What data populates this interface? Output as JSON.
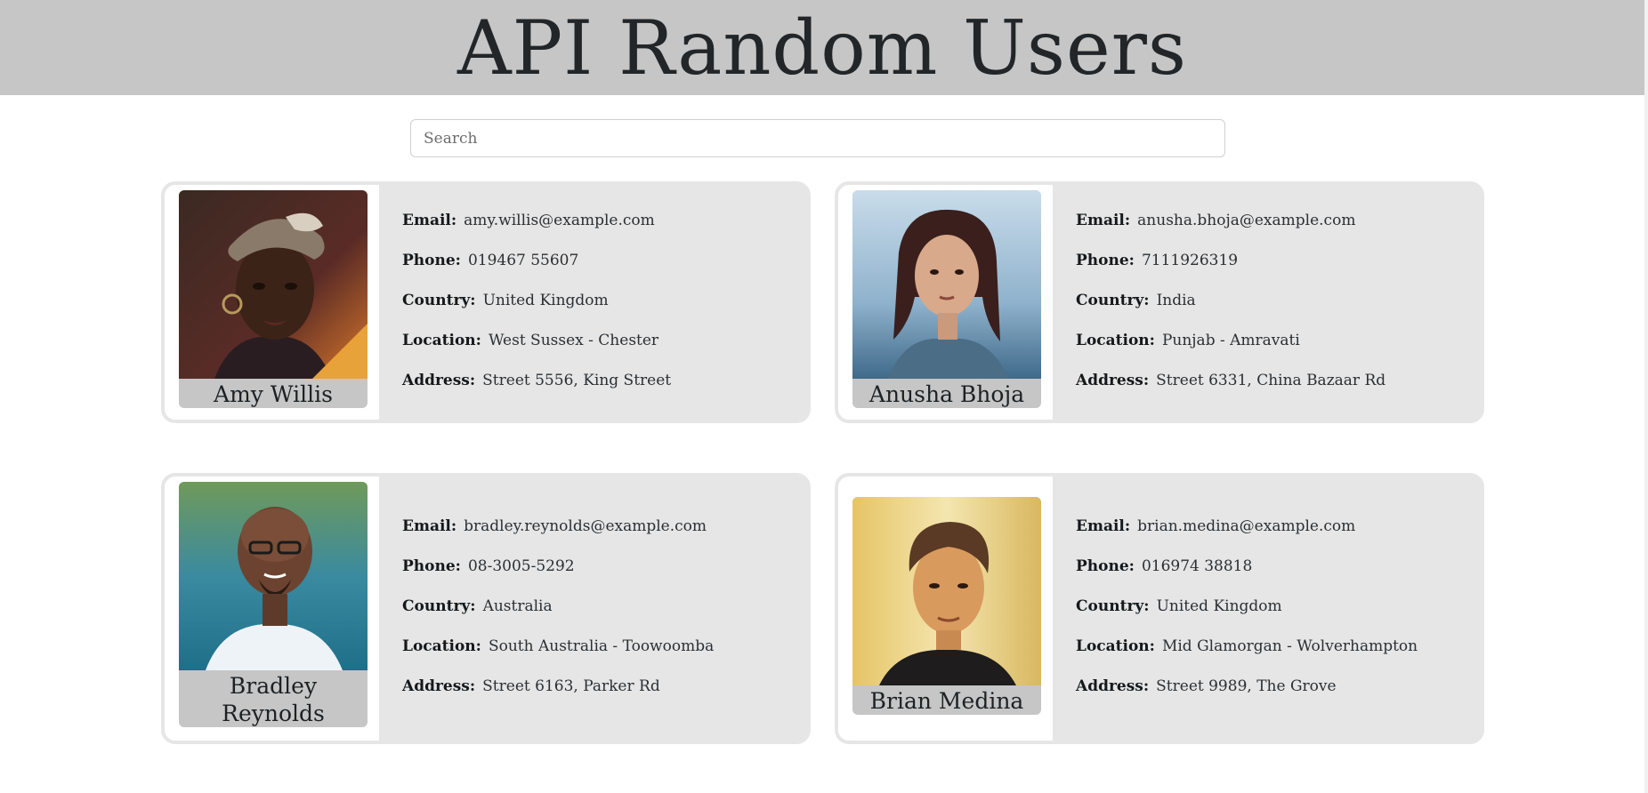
{
  "header": {
    "title": "API Random Users"
  },
  "search": {
    "placeholder": "Search",
    "value": ""
  },
  "labels": {
    "email": "Email:",
    "phone": "Phone:",
    "country": "Country:",
    "location": "Location:",
    "address": "Address:"
  },
  "users": [
    {
      "name": "Amy Willis",
      "email": "amy.willis@example.com",
      "phone": "019467 55607",
      "country": "United Kingdom",
      "location": "West Sussex - Chester",
      "address": "Street 5556, King Street"
    },
    {
      "name": "Anusha Bhoja",
      "email": "anusha.bhoja@example.com",
      "phone": "7111926319",
      "country": "India",
      "location": "Punjab - Amravati",
      "address": "Street 6331, China Bazaar Rd"
    },
    {
      "name": "Bradley Reynolds",
      "email": "bradley.reynolds@example.com",
      "phone": "08-3005-5292",
      "country": "Australia",
      "location": "South Australia - Toowoomba",
      "address": "Street 6163, Parker Rd"
    },
    {
      "name": "Brian Medina",
      "email": "brian.medina@example.com",
      "phone": "016974 38818",
      "country": "United Kingdom",
      "location": "Mid Glamorgan - Wolverhampton",
      "address": "Street 9989, The Grove"
    }
  ],
  "colors": {
    "header_bg": "#c6c6c6",
    "card_bg": "#e6e6e6",
    "name_bg": "#c6c6c6",
    "text": "#222629"
  }
}
